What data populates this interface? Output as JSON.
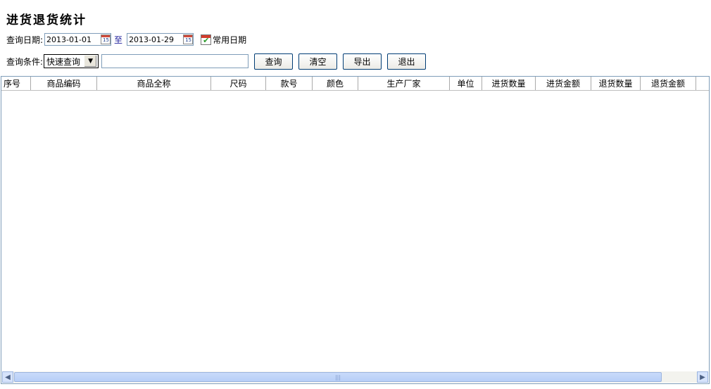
{
  "title": "进货退货统计",
  "date_row": {
    "label": "查询日期:",
    "start_date": "2013-01-01",
    "separator": "至",
    "end_date": "2013-01-29",
    "common_dates_label": "常用日期"
  },
  "query_row": {
    "label": "查询条件:",
    "mode_selected": "快速查询",
    "input_value": "",
    "buttons": {
      "query": "查询",
      "clear": "清空",
      "export": "导出",
      "exit": "退出"
    }
  },
  "table": {
    "columns": [
      "序号",
      "商品编码",
      "商品全称",
      "尺码",
      "款号",
      "颜色",
      "生产厂家",
      "单位",
      "进货数量",
      "进货金额",
      "退货数量",
      "退货金额"
    ],
    "rows": []
  },
  "scrollbar": {
    "thumb_grip": "|||"
  },
  "icons": {
    "calendar": "calendar-icon",
    "common_dates": "calendar-check-icon",
    "dropdown": "chevron-down-icon",
    "scroll_left": "arrow-left-icon",
    "scroll_right": "arrow-right-icon"
  }
}
